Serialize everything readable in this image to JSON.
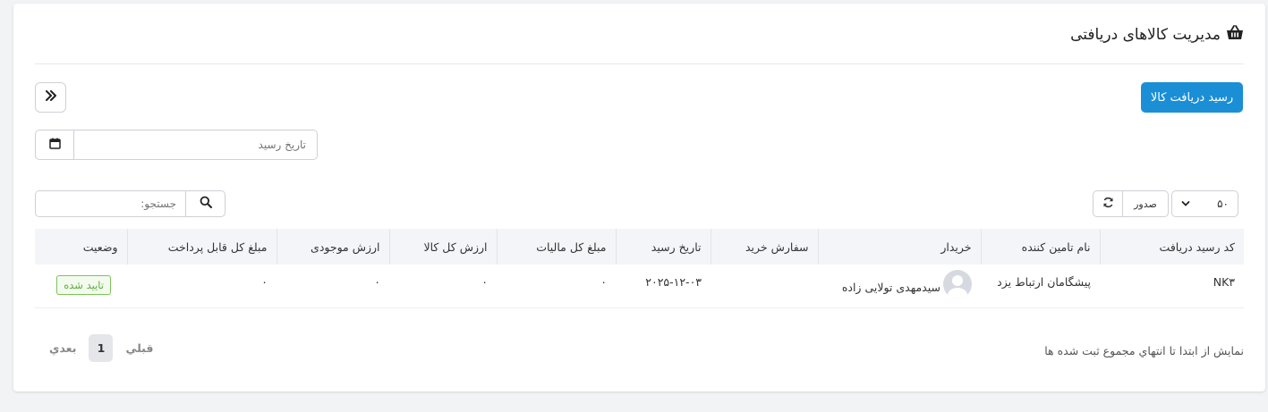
{
  "header": {
    "title": "مدیریت کالاهای دریافتی",
    "icon": "basket-icon"
  },
  "actions": {
    "receive_button_label": "رسید دریافت کالا",
    "collapse_icon": "double-chevron-icon"
  },
  "filters": {
    "receipt_date_placeholder": "تاریخ رسید",
    "calendar_icon": "calendar-icon"
  },
  "search": {
    "placeholder": "جستجو:",
    "icon": "search-icon"
  },
  "toolbar": {
    "page_size": "۵۰",
    "export_label": "صدور",
    "refresh_icon": "refresh-icon"
  },
  "table": {
    "columns": [
      "کد رسید دریافت",
      "نام تامین کننده",
      "خریدار",
      "سفارش خرید",
      "تاریخ رسید",
      "مبلغ کل مالیات",
      "ارزش کل کالا",
      "ارزش موجودی",
      "مبلغ کل قابل پرداخت",
      "وضعیت"
    ],
    "rows": [
      {
        "code": "NK۳",
        "supplier": "پیشگامان ارتباط یزد",
        "buyer": "سیدمهدی تولایی زاده",
        "purchase_order": "",
        "receipt_date": "۲۰۲۵-۱۲-۰۳",
        "total_tax": "۰",
        "total_goods_value": "۰",
        "inventory_value": "۰",
        "total_payable": "۰",
        "status": "تایید شده"
      }
    ]
  },
  "footer": {
    "info": "نمايش از ابتدا تا انتهاي مجموع ثبت شده ها",
    "prev_label": "قبلي",
    "current_page": "1",
    "next_label": "بعدي"
  },
  "colors": {
    "primary": "#1a8fd6",
    "status_green": "#5fae3a",
    "header_bg": "#f4f5f8"
  }
}
